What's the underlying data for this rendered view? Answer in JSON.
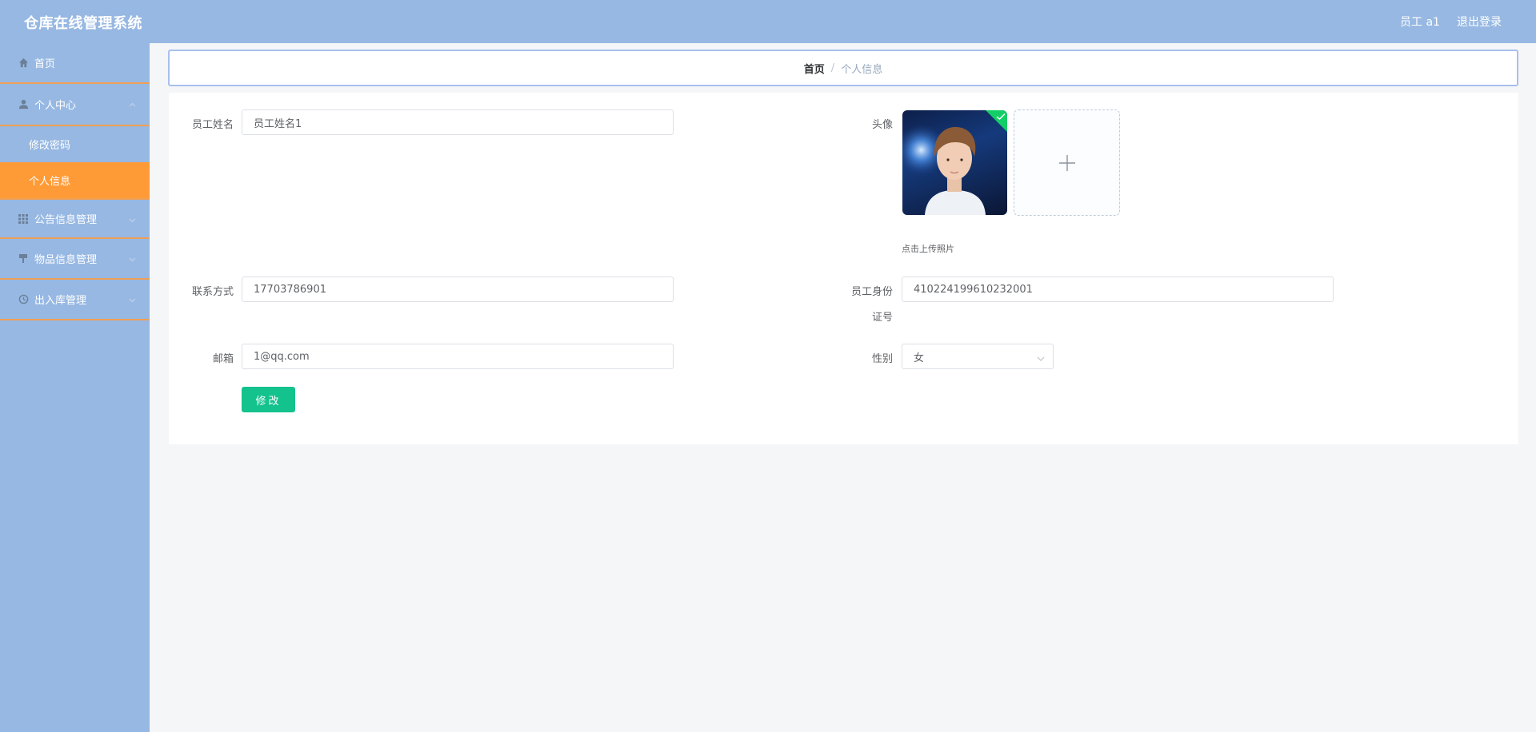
{
  "header": {
    "title": "仓库在线管理系统",
    "user": "员工 a1",
    "logout": "退出登录"
  },
  "sidebar": {
    "items": [
      {
        "label": "首页",
        "icon": "home-icon"
      },
      {
        "label": "个人中心",
        "icon": "user-icon",
        "expanded": true,
        "children": [
          {
            "label": "修改密码"
          },
          {
            "label": "个人信息",
            "active": true
          }
        ]
      },
      {
        "label": "公告信息管理",
        "icon": "grid-icon"
      },
      {
        "label": "物品信息管理",
        "icon": "goods-icon"
      },
      {
        "label": "出入库管理",
        "icon": "clock-icon"
      }
    ]
  },
  "breadcrumb": {
    "home": "首页",
    "separator": "/",
    "current": "个人信息"
  },
  "form": {
    "name_label": "员工姓名",
    "name_value": "员工姓名1",
    "avatar_label": "头像",
    "upload_tip": "点击上传照片",
    "phone_label": "联系方式",
    "phone_value": "17703786901",
    "idcard_label_1": "员工身份",
    "idcard_label_2": "证号",
    "idcard_value": "410224199610232001",
    "email_label": "邮箱",
    "email_value": "1@qq.com",
    "gender_label": "性别",
    "gender_value": "女",
    "submit_label": "修改"
  },
  "colors": {
    "header": "#97b8e2",
    "sidebar": "#97b8e2",
    "active": "#ff9b37",
    "divider": "#ef9f55",
    "primary": "#13c28d",
    "success": "#13ce66"
  }
}
